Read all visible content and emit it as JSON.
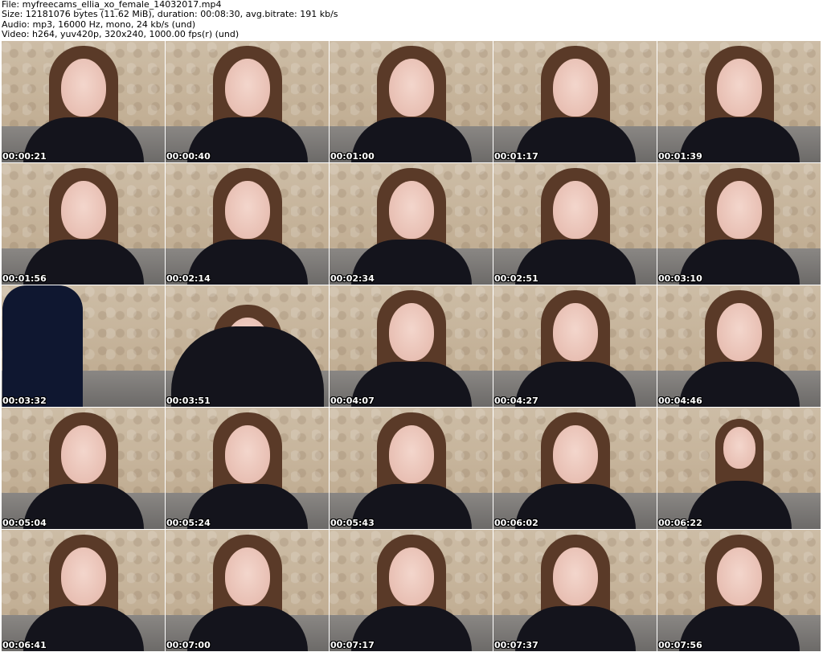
{
  "header": {
    "file_line": "File: myfreecams_ellia_xo_female_14032017.mp4",
    "size_line": "Size: 12181076 bytes (11.62 MiB), duration: 00:08:30, avg.bitrate: 191 kb/s",
    "audio_line": "Audio: mp3, 16000 Hz, mono, 24 kb/s (und)",
    "video_line": "Video: h264, yuv420p, 320x240, 1000.00 fps(r) (und)"
  },
  "thumbnails": [
    {
      "timestamp": "00:00:21"
    },
    {
      "timestamp": "00:00:40"
    },
    {
      "timestamp": "00:01:00"
    },
    {
      "timestamp": "00:01:17"
    },
    {
      "timestamp": "00:01:39"
    },
    {
      "timestamp": "00:01:56"
    },
    {
      "timestamp": "00:02:14"
    },
    {
      "timestamp": "00:02:34"
    },
    {
      "timestamp": "00:02:51"
    },
    {
      "timestamp": "00:03:10"
    },
    {
      "timestamp": "00:03:32"
    },
    {
      "timestamp": "00:03:51"
    },
    {
      "timestamp": "00:04:07"
    },
    {
      "timestamp": "00:04:27"
    },
    {
      "timestamp": "00:04:46"
    },
    {
      "timestamp": "00:05:04"
    },
    {
      "timestamp": "00:05:24"
    },
    {
      "timestamp": "00:05:43"
    },
    {
      "timestamp": "00:06:02"
    },
    {
      "timestamp": "00:06:22"
    },
    {
      "timestamp": "00:06:41"
    },
    {
      "timestamp": "00:07:00"
    },
    {
      "timestamp": "00:07:17"
    },
    {
      "timestamp": "00:07:37"
    },
    {
      "timestamp": "00:07:56"
    }
  ]
}
